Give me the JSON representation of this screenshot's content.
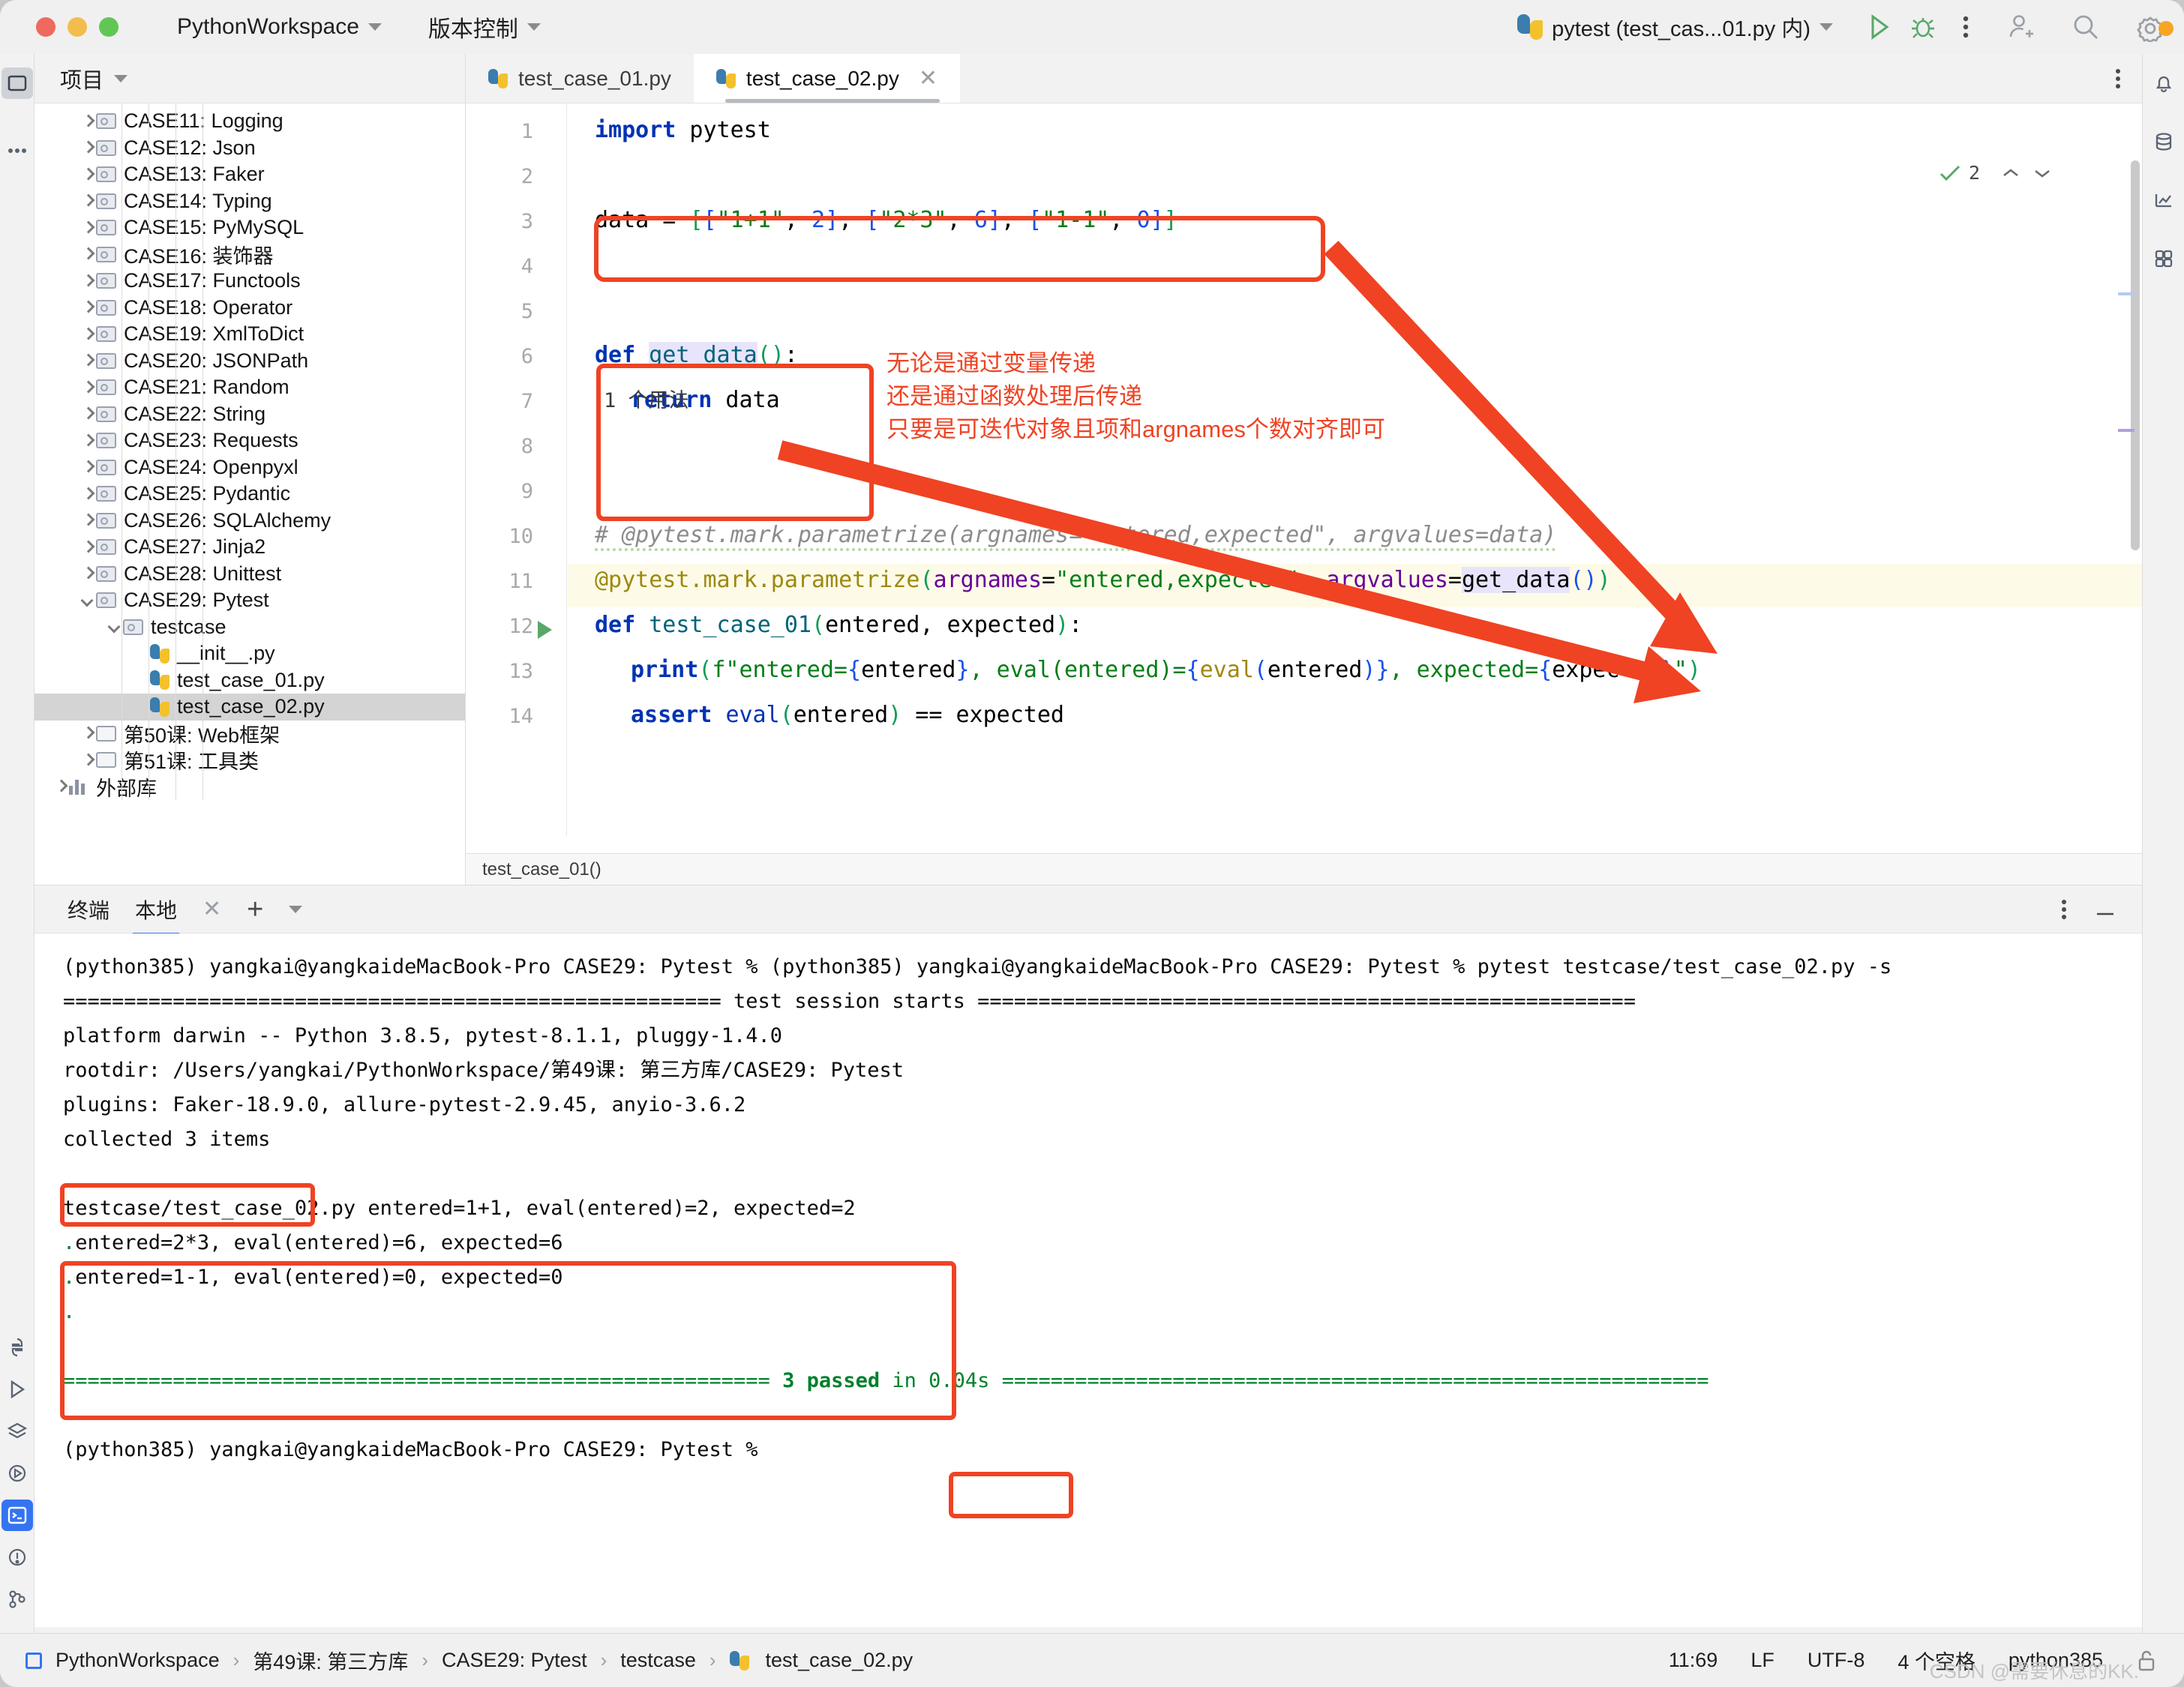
{
  "titlebar": {
    "project_name": "PythonWorkspace",
    "vcs_label": "版本控制",
    "run_config": "pytest (test_cas...01.py 内)",
    "run_icon": "run-triangle-icon",
    "debug_icon": "debug-bug-icon",
    "more_icon": "more-vertical-icon",
    "account_icon": "add-user-icon",
    "search_icon": "search-icon",
    "settings_icon": "gear-icon"
  },
  "project_panel": {
    "title": "项目",
    "tree": [
      {
        "label": "CASE11: Logging",
        "kind": "folder",
        "depth": 1,
        "state": "collapsed"
      },
      {
        "label": "CASE12: Json",
        "kind": "folder",
        "depth": 1,
        "state": "collapsed"
      },
      {
        "label": "CASE13: Faker",
        "kind": "folder",
        "depth": 1,
        "state": "collapsed"
      },
      {
        "label": "CASE14: Typing",
        "kind": "folder",
        "depth": 1,
        "state": "collapsed"
      },
      {
        "label": "CASE15: PyMySQL",
        "kind": "folder",
        "depth": 1,
        "state": "collapsed"
      },
      {
        "label": "CASE16: 装饰器",
        "kind": "folder",
        "depth": 1,
        "state": "collapsed"
      },
      {
        "label": "CASE17: Functools",
        "kind": "folder",
        "depth": 1,
        "state": "collapsed"
      },
      {
        "label": "CASE18: Operator",
        "kind": "folder",
        "depth": 1,
        "state": "collapsed"
      },
      {
        "label": "CASE19: XmlToDict",
        "kind": "folder",
        "depth": 1,
        "state": "collapsed"
      },
      {
        "label": "CASE20: JSONPath",
        "kind": "folder",
        "depth": 1,
        "state": "collapsed"
      },
      {
        "label": "CASE21: Random",
        "kind": "folder",
        "depth": 1,
        "state": "collapsed"
      },
      {
        "label": "CASE22: String",
        "kind": "folder",
        "depth": 1,
        "state": "collapsed"
      },
      {
        "label": "CASE23: Requests",
        "kind": "folder",
        "depth": 1,
        "state": "collapsed"
      },
      {
        "label": "CASE24: Openpyxl",
        "kind": "folder",
        "depth": 1,
        "state": "collapsed"
      },
      {
        "label": "CASE25: Pydantic",
        "kind": "folder",
        "depth": 1,
        "state": "collapsed"
      },
      {
        "label": "CASE26: SQLAlchemy",
        "kind": "folder",
        "depth": 1,
        "state": "collapsed"
      },
      {
        "label": "CASE27: Jinja2",
        "kind": "folder",
        "depth": 1,
        "state": "collapsed"
      },
      {
        "label": "CASE28: Unittest",
        "kind": "folder",
        "depth": 1,
        "state": "collapsed"
      },
      {
        "label": "CASE29: Pytest",
        "kind": "folder",
        "depth": 1,
        "state": "expanded"
      },
      {
        "label": "testcase",
        "kind": "folder",
        "depth": 2,
        "state": "expanded"
      },
      {
        "label": "__init__.py",
        "kind": "python",
        "depth": 3,
        "state": "leaf"
      },
      {
        "label": "test_case_01.py",
        "kind": "python",
        "depth": 3,
        "state": "leaf"
      },
      {
        "label": "test_case_02.py",
        "kind": "python",
        "depth": 3,
        "state": "leaf",
        "selected": true
      },
      {
        "label": "第50课: Web框架",
        "kind": "folder-plain",
        "depth": 1,
        "state": "collapsed"
      },
      {
        "label": "第51课: 工具类",
        "kind": "folder-plain",
        "depth": 1,
        "state": "collapsed"
      },
      {
        "label": "外部库",
        "kind": "library",
        "depth": 0,
        "state": "collapsed"
      }
    ]
  },
  "editor": {
    "tabs": [
      {
        "label": "test_case_01.py",
        "active": false,
        "closable": false
      },
      {
        "label": "test_case_02.py",
        "active": true,
        "closable": true,
        "close_icon": "close-icon"
      }
    ],
    "inspection_count": "2",
    "breadcrumb": "test_case_01()",
    "line_numbers": [
      "1",
      "2",
      "3",
      "4",
      "5",
      "6",
      "7",
      "8",
      "9",
      "10",
      "11",
      "12",
      "13",
      "14"
    ],
    "lines": {
      "l1_import": "import",
      "l1_module": " pytest",
      "l3": "data = [[\"1+1\", 2], [\"2*3\", 6], [\"1-1\", 0]]",
      "l6_def": "def",
      "l6_name": "get_data",
      "l6_tail": "():",
      "l7_return": "return",
      "l7_value": " data",
      "l10_comment": "# @pytest.mark.parametrize(argnames=\"entered,expected\", argvalues=data)",
      "l11_deco": "@pytest.mark.parametrize",
      "l11_argnames": "argnames",
      "l11_argnames_val": "\"entered,expected\"",
      "l11_argvalues": "argvalues",
      "l11_argvalues_val": "get_data",
      "l12_def": "def",
      "l12_name": "test_case_01",
      "l12_params": "entered, expected",
      "l13_print": "print",
      "l13_fstring": "f\"entered={entered}, eval(entered)={eval(entered)}, expected={expected}\"",
      "l14_assert": "assert",
      "l14_body": " eval(entered) == expected"
    }
  },
  "annotations": {
    "usage_hint": "1 个用法",
    "note_line1": "无论是通过变量传递",
    "note_line2": "还是通过函数处理后传递",
    "note_line3": "只要是可迭代对象且项和argnames个数对齐即可",
    "box_color": "#ef4323"
  },
  "terminal": {
    "title": "终端",
    "tab_label": "本地",
    "close_icon": "close-icon",
    "add_icon": "plus-icon",
    "dropdown_icon": "chevron-down-icon",
    "options_icon": "more-vertical-icon",
    "minimize_icon": "minimize-icon",
    "lines": [
      {
        "text": "(python385) yangkai@yangkaideMacBook-Pro CASE29: Pytest % (python385) yangkai@yangkaideMacBook-Pro CASE29: Pytest % pytest testcase/test_case_02.py -s",
        "color": "black"
      },
      {
        "text": "====================================================== test session starts ======================================================",
        "color": "black"
      },
      {
        "text": "platform darwin -- Python 3.8.5, pytest-8.1.1, pluggy-1.4.0",
        "color": "black"
      },
      {
        "text": "rootdir: /Users/yangkai/PythonWorkspace/第49课: 第三方库/CASE29: Pytest",
        "color": "black"
      },
      {
        "text": "plugins: Faker-18.9.0, allure-pytest-2.9.45, anyio-3.6.2",
        "color": "black"
      },
      {
        "text": "collected 3 items",
        "color": "black",
        "boxed": true
      },
      {
        "text": "",
        "color": "black"
      },
      {
        "text": "testcase/test_case_02.py entered=1+1, eval(entered)=2, expected=2",
        "color": "black"
      },
      {
        "text": ".entered=2*3, eval(entered)=6, expected=6",
        "color": "black",
        "dot": true
      },
      {
        "text": ".entered=1-1, eval(entered)=0, expected=0",
        "color": "black",
        "dot": true
      },
      {
        "text": ".",
        "color": "green"
      },
      {
        "text": "",
        "color": "black"
      }
    ],
    "summary_left": "========================================================== ",
    "summary_passed": "3 passed",
    "summary_mid": " in 0.04s ",
    "summary_right": "==========================================================",
    "final_prompt": "(python385) yangkai@yangkaideMacBook-Pro CASE29: Pytest %"
  },
  "status_bar": {
    "crumbs": [
      "PythonWorkspace",
      "第49课: 第三方库",
      "CASE29: Pytest",
      "testcase",
      "test_case_02.py"
    ],
    "separator": "›",
    "caret": "11:69",
    "line_sep": "LF",
    "encoding": "UTF-8",
    "indent": "4 个空格",
    "interpreter": "python385",
    "lock_icon": "lock-open-icon",
    "watermark": "CSDN @需要休息的KK."
  }
}
